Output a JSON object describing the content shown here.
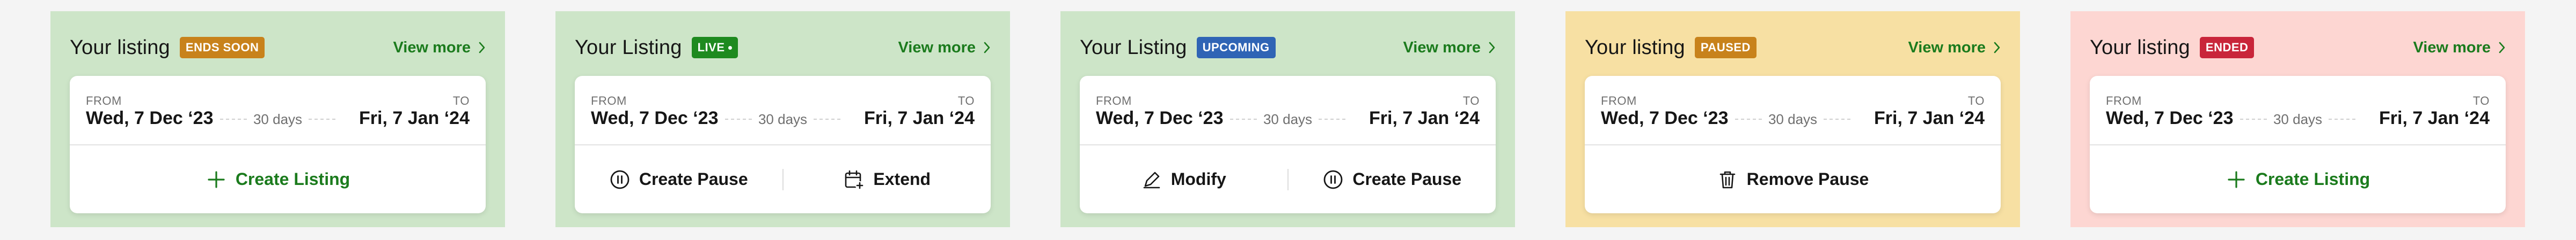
{
  "cards": [
    {
      "title": "Your listing",
      "badge": "ENDS SOON",
      "badge_color": "#c8821b",
      "badge_dot": false,
      "bg": "#cde5c8",
      "view_more": "View more",
      "from_label": "FROM",
      "from_date": "Wed, 7 Dec ‘23",
      "duration": "30 days",
      "to_label": "TO",
      "to_date": "Fri, 7 Jan ‘24",
      "actions": [
        {
          "label": "Create Listing",
          "icon": "plus-icon",
          "green": true
        }
      ]
    },
    {
      "title": "Your Listing",
      "badge": "LIVE",
      "badge_color": "#1e8a1f",
      "badge_dot": true,
      "bg": "#cde5c8",
      "view_more": "View more",
      "from_label": "FROM",
      "from_date": "Wed, 7 Dec ‘23",
      "duration": "30 days",
      "to_label": "TO",
      "to_date": "Fri, 7 Jan ‘24",
      "actions": [
        {
          "label": "Create Pause",
          "icon": "pause-icon",
          "green": false
        },
        {
          "label": "Extend",
          "icon": "calendar-plus-icon",
          "green": false
        }
      ]
    },
    {
      "title": "Your Listing",
      "badge": "UPCOMING",
      "badge_color": "#2f64b5",
      "badge_dot": false,
      "bg": "#cde5c8",
      "view_more": "View more",
      "from_label": "FROM",
      "from_date": "Wed, 7 Dec ‘23",
      "duration": "30 days",
      "to_label": "TO",
      "to_date": "Fri, 7 Jan ‘24",
      "actions": [
        {
          "label": "Modify",
          "icon": "pencil-icon",
          "green": false
        },
        {
          "label": "Create Pause",
          "icon": "pause-icon",
          "green": false
        }
      ]
    },
    {
      "title": "Your listing",
      "badge": "PAUSED",
      "badge_color": "#c8821b",
      "badge_dot": false,
      "bg": "#f7e0a3",
      "view_more": "View more",
      "from_label": "FROM",
      "from_date": "Wed, 7 Dec ‘23",
      "duration": "30 days",
      "to_label": "TO",
      "to_date": "Fri, 7 Jan ‘24",
      "actions": [
        {
          "label": "Remove Pause",
          "icon": "trash-icon",
          "green": false
        }
      ]
    },
    {
      "title": "Your listing",
      "badge": "ENDED",
      "badge_color": "#c9253a",
      "badge_dot": false,
      "bg": "#fdd6d2",
      "view_more": "View more",
      "from_label": "FROM",
      "from_date": "Wed, 7 Dec ‘23",
      "duration": "30 days",
      "to_label": "TO",
      "to_date": "Fri, 7 Jan ‘24",
      "actions": [
        {
          "label": "Create Listing",
          "icon": "plus-icon",
          "green": true
        }
      ]
    }
  ]
}
